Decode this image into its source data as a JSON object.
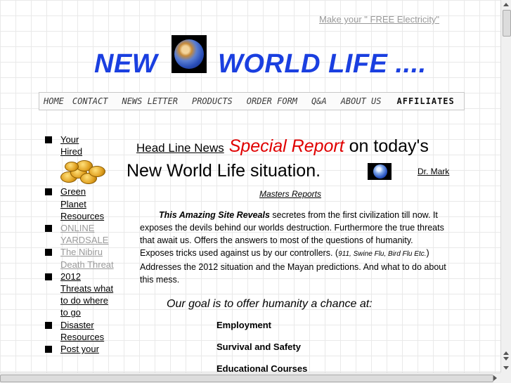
{
  "top_link": "Make your \" FREE  Electricity\"",
  "banner": {
    "left_word": "NEW",
    "right_word": "WORLD LIFE  ...."
  },
  "nav": {
    "items": [
      "HOME",
      "CONTACT",
      "NEWS LETTER",
      "PRODUCTS",
      "ORDER FORM",
      "Q&A",
      "ABOUT US"
    ],
    "affiliates": "AFFILIATES"
  },
  "sidebar": {
    "items": [
      {
        "label_line1": "Your",
        "label_line2": "Hired",
        "faded": false
      },
      {
        "label": "Green Planet Resources",
        "faded": false
      },
      {
        "label": "ONLINE YARDSALE",
        "faded": true
      },
      {
        "label": "The Nibiru Death Threat",
        "faded": true
      },
      {
        "label": "2012 Threats what to do where to go",
        "faded": false
      },
      {
        "label": "Disaster Resources",
        "faded": false
      },
      {
        "label": "Post your",
        "faded": false
      }
    ]
  },
  "content": {
    "headline_news": "Head Line News",
    "special_report": "Special Report",
    "on_todays": " on today's",
    "line2": "New World Life situation.",
    "dr_mark": "Dr. Mark",
    "masters_reports": "Masters Reports",
    "para_lead": "This Amazing Site Reveals",
    "para_text1": " secretes from the first civilization till now.  It exposes the devils behind our worlds destruction.  Furthermore the true threats that await us.  Offers the answers to most of the questions of humanity.  Exposes tricks used against us by our controllers. (",
    "para_small": "911, Swine Flu,  Bird Flu  Etc.",
    "para_text2": ")  Addresses the 2012 situation and the Mayan predictions.  And what to do about this mess.",
    "goal": "Our goal is to offer humanity a chance at:",
    "offers": [
      "Employment",
      "Survival and Safety",
      "Educational Courses"
    ]
  },
  "colors": {
    "banner_blue": "#1a3fe0",
    "special_red": "#e00000",
    "faded_link": "#9a9a9a"
  }
}
